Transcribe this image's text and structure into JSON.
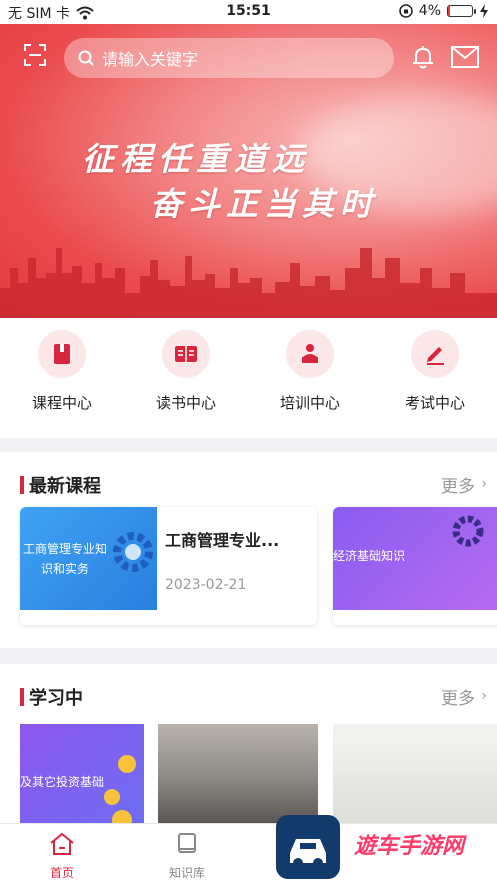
{
  "status": {
    "carrier": "无 SIM 卡",
    "time": "15:51",
    "battery": "4%"
  },
  "header": {
    "search_placeholder": "请输入关键字"
  },
  "banner": {
    "line1": "征程任重道远",
    "line2": "奋斗正当其时"
  },
  "quick_menu": [
    {
      "label": "课程中心",
      "icon": "book-icon"
    },
    {
      "label": "读书中心",
      "icon": "open-book-icon"
    },
    {
      "label": "培训中心",
      "icon": "lecturer-icon"
    },
    {
      "label": "考试中心",
      "icon": "pencil-icon"
    }
  ],
  "latest": {
    "title": "最新课程",
    "more": "更多",
    "cards": [
      {
        "thumb_text": "工商管理专业知识和实务",
        "title": "工商管理专业...",
        "date": "2023-02-21"
      },
      {
        "thumb_text": "经济基础知识"
      }
    ]
  },
  "learning": {
    "title": "学习中",
    "more": "更多",
    "cards": [
      {
        "thumb_text": "及其它投资基础"
      },
      {
        "thumb_text": ""
      },
      {
        "thumb_text": ""
      }
    ]
  },
  "tabs": [
    {
      "label": "首页",
      "icon": "home-icon",
      "active": true
    },
    {
      "label": "知识库",
      "icon": "library-icon",
      "active": false
    }
  ],
  "watermark": {
    "text": "遊车手游网"
  },
  "colors": {
    "accent": "#d7263d",
    "banner_red": "#e23a3f"
  }
}
